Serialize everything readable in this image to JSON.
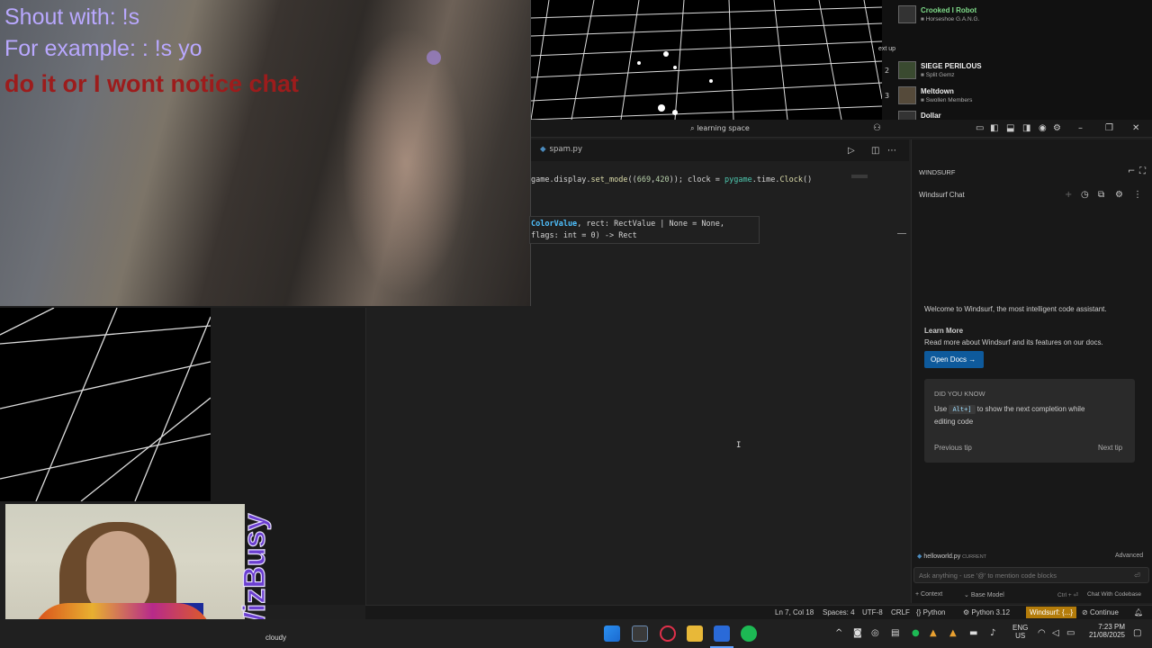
{
  "overlay": {
    "shout_line": "Shout with: !s",
    "example_line": "For example: : !s yo",
    "notice_line": "do it or I wont notice chat"
  },
  "playlist": {
    "up_next_label": "ext up",
    "items": [
      {
        "num": "",
        "title": "Crooked I Robot",
        "artist": "Horseshoe G.A.N.G."
      },
      {
        "num": "2",
        "title": "SIEGE PERILOUS",
        "artist": "Split Gemz"
      },
      {
        "num": "3",
        "title": "Meltdown",
        "artist": "Swollen Members"
      },
      {
        "num": "",
        "title": "Dollar",
        "artist": ""
      }
    ]
  },
  "titlebar": {
    "search_text": "learning space"
  },
  "tabs": [
    {
      "label": "spam.py"
    }
  ],
  "code": {
    "line1": {
      "pre": "game.display.",
      "fn": "set_mode",
      "args_open": "((",
      "n1": "669",
      "comma": ",",
      "n2": "420",
      "args_close": ")); clock = ",
      "mod": "pygame",
      "dot": ".time.",
      "fn2": "Clock",
      "end": "()"
    },
    "hover_line1_a": "ColorValue",
    "hover_line1_b": ", rect: RectValue | None = None,",
    "hover_line2": "flags: int = 0) -> Rect"
  },
  "windsurf": {
    "header": "WINDSURF",
    "chat_title": "Windsurf Chat",
    "welcome": "Welcome to Windsurf, the most intelligent code assistant.",
    "learn_more": "Learn More",
    "learn_more_desc": "Read more about Windsurf and its features on our docs.",
    "open_docs": "Open Docs →",
    "did_you_know": "DID YOU KNOW",
    "tip_pre": "Use",
    "tip_key": "Alt+]",
    "tip_post": "to show the next completion while",
    "tip_line2": "editing code",
    "prev_tip": "Previous tip",
    "next_tip": "Next tip",
    "file_chip": "helloworld.py",
    "file_chip_badge": "CURRENT",
    "advanced": "Advanced",
    "input_placeholder": "Ask anything - use '@' to mention code blocks",
    "context": "+ Context",
    "model": "Base Model",
    "shortcut": "Ctrl + ⏎",
    "chat_with": "Chat With Codebase"
  },
  "statusbar": {
    "position": "Ln 7, Col 18",
    "spaces": "Spaces: 4",
    "encoding": "UTF-8",
    "eol": "CRLF",
    "lang": "Python",
    "interpreter": "Python 3.12",
    "windsurf": "Windsurf: {...}",
    "continue": "Continue"
  },
  "webcam": {
    "overlay_text": "WizBusy"
  },
  "taskbar": {
    "weather": "cloudy",
    "lang_top": "ENG",
    "lang_bottom": "US",
    "time": "7:23 PM",
    "date": "21/08/2025"
  },
  "colors": {
    "accent": "#0e5a9c",
    "statusbar_highlight": "#b47c0a",
    "overlay_text": "#b9a8ff",
    "overlay_red": "#9c1c1c"
  }
}
